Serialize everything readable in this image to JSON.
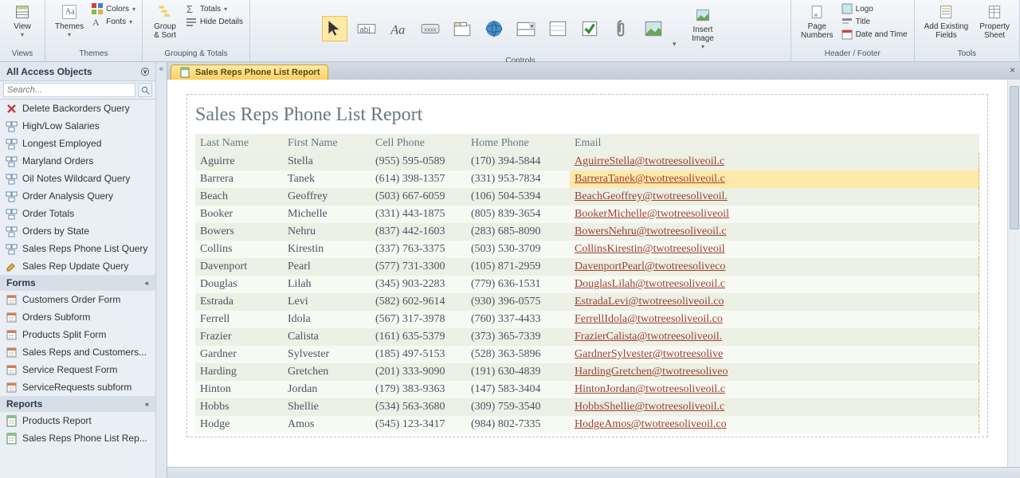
{
  "ribbon": {
    "view_label": "View",
    "views_group": "Views",
    "themes_label": "Themes",
    "colors_label": "Colors",
    "fonts_label": "Fonts",
    "themes_group": "Themes",
    "group_sort_label": "Group\n& Sort",
    "totals_label": "Totals",
    "hide_details_label": "Hide Details",
    "grouping_group": "Grouping & Totals",
    "controls_group": "Controls",
    "insert_image_label": "Insert\nImage",
    "logo_label": "Logo",
    "title_label": "Title",
    "datetime_label": "Date and Time",
    "page_numbers_label": "Page\nNumbers",
    "headerfooter_group": "Header / Footer",
    "add_fields_label": "Add Existing\nFields",
    "property_sheet_label": "Property\nSheet",
    "tools_group": "Tools"
  },
  "nav": {
    "title": "All Access Objects",
    "search_placeholder": "Search...",
    "queries": [
      "Delete Backorders Query",
      "High/Low Salaries",
      "Longest Employed",
      "Maryland Orders",
      "Oil Notes Wildcard Query",
      "Order Analysis Query",
      "Order Totals",
      "Orders by State",
      "Sales Reps Phone List Query",
      "Sales Rep Update Query"
    ],
    "forms_header": "Forms",
    "forms": [
      "Customers Order Form",
      "Orders Subform",
      "Products Split Form",
      "Sales Reps and Customers...",
      "Service Request Form",
      "ServiceRequests subform"
    ],
    "reports_header": "Reports",
    "reports": [
      "Products Report",
      "Sales Reps Phone List Rep..."
    ]
  },
  "tab": {
    "label": "Sales Reps Phone List Report"
  },
  "report": {
    "title": "Sales Reps Phone List Report",
    "headers": [
      "Last Name",
      "First Name",
      "Cell Phone",
      "Home Phone",
      "Email"
    ],
    "rows": [
      {
        "last": "Aguirre",
        "first": "Stella",
        "cell": "(955) 595-0589",
        "home": "(170) 394-5844",
        "email": "AguirreStella@twotreesoliveoil.c"
      },
      {
        "last": "Barrera",
        "first": "Tanek",
        "cell": "(614) 398-1357",
        "home": "(331) 953-7834",
        "email": "BarreraTanek@twotreesoliveoil.c",
        "hl": true
      },
      {
        "last": "Beach",
        "first": "Geoffrey",
        "cell": "(503) 667-6059",
        "home": "(106) 504-5394",
        "email": "BeachGeoffrey@twotreesoliveoil."
      },
      {
        "last": "Booker",
        "first": "Michelle",
        "cell": "(331) 443-1875",
        "home": "(805) 839-3654",
        "email": "BookerMichelle@twotreesoliveoil"
      },
      {
        "last": "Bowers",
        "first": "Nehru",
        "cell": "(837) 442-1603",
        "home": "(283) 685-8090",
        "email": "BowersNehru@twotreesoliveoil.c"
      },
      {
        "last": "Collins",
        "first": "Kirestin",
        "cell": "(337) 763-3375",
        "home": "(503) 530-3709",
        "email": "CollinsKirestin@twotreesoliveoil"
      },
      {
        "last": "Davenport",
        "first": "Pearl",
        "cell": "(577) 731-3300",
        "home": "(105) 871-2959",
        "email": "DavenportPearl@twotreesoliveco"
      },
      {
        "last": "Douglas",
        "first": "Lilah",
        "cell": "(345) 903-2283",
        "home": "(779) 636-1531",
        "email": "DouglasLilah@twotreesoliveoil.c"
      },
      {
        "last": "Estrada",
        "first": "Levi",
        "cell": "(582) 602-9614",
        "home": "(930) 396-0575",
        "email": "EstradaLevi@twotreesoliveoil.co"
      },
      {
        "last": "Ferrell",
        "first": "Idola",
        "cell": "(567) 317-3978",
        "home": "(760) 337-4433",
        "email": "FerrellIdola@twotreesoliveoil.co"
      },
      {
        "last": "Frazier",
        "first": "Calista",
        "cell": "(161) 635-5379",
        "home": "(373) 365-7339",
        "email": "FrazierCalista@twotreesoliveoil."
      },
      {
        "last": "Gardner",
        "first": "Sylvester",
        "cell": "(185) 497-5153",
        "home": "(528) 363-5896",
        "email": "GardnerSylvester@twotreesolive"
      },
      {
        "last": "Harding",
        "first": "Gretchen",
        "cell": "(201) 333-9090",
        "home": "(191) 630-4839",
        "email": "HardingGretchen@twotreesoliveo"
      },
      {
        "last": "Hinton",
        "first": "Jordan",
        "cell": "(179) 383-9363",
        "home": "(147) 583-3404",
        "email": "HintonJordan@twotreesoliveoil.c"
      },
      {
        "last": "Hobbs",
        "first": "Shellie",
        "cell": "(534) 563-3680",
        "home": "(309) 759-3540",
        "email": "HobbsShellie@twotreesoliveoil.c"
      },
      {
        "last": "Hodge",
        "first": "Amos",
        "cell": "(545) 123-3417",
        "home": "(984) 802-7335",
        "email": "HodgeAmos@twotreesoliveoil.co"
      }
    ]
  }
}
